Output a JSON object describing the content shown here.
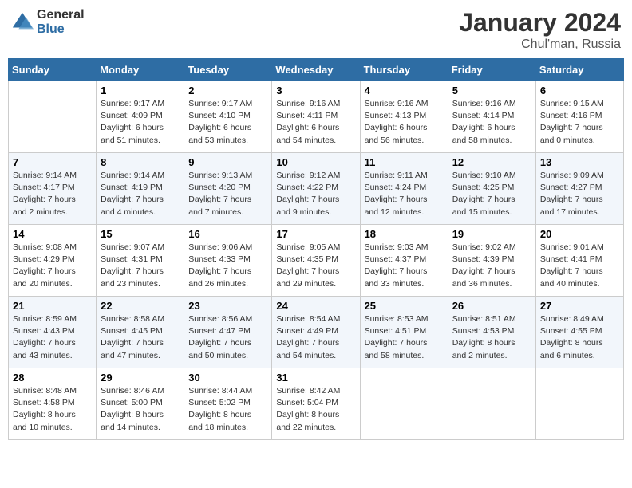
{
  "header": {
    "logo_general": "General",
    "logo_blue": "Blue",
    "title": "January 2024",
    "subtitle": "Chul'man, Russia"
  },
  "columns": [
    "Sunday",
    "Monday",
    "Tuesday",
    "Wednesday",
    "Thursday",
    "Friday",
    "Saturday"
  ],
  "weeks": [
    [
      {
        "num": "",
        "sunrise": "",
        "sunset": "",
        "daylight": ""
      },
      {
        "num": "1",
        "sunrise": "Sunrise: 9:17 AM",
        "sunset": "Sunset: 4:09 PM",
        "daylight": "Daylight: 6 hours and 51 minutes."
      },
      {
        "num": "2",
        "sunrise": "Sunrise: 9:17 AM",
        "sunset": "Sunset: 4:10 PM",
        "daylight": "Daylight: 6 hours and 53 minutes."
      },
      {
        "num": "3",
        "sunrise": "Sunrise: 9:16 AM",
        "sunset": "Sunset: 4:11 PM",
        "daylight": "Daylight: 6 hours and 54 minutes."
      },
      {
        "num": "4",
        "sunrise": "Sunrise: 9:16 AM",
        "sunset": "Sunset: 4:13 PM",
        "daylight": "Daylight: 6 hours and 56 minutes."
      },
      {
        "num": "5",
        "sunrise": "Sunrise: 9:16 AM",
        "sunset": "Sunset: 4:14 PM",
        "daylight": "Daylight: 6 hours and 58 minutes."
      },
      {
        "num": "6",
        "sunrise": "Sunrise: 9:15 AM",
        "sunset": "Sunset: 4:16 PM",
        "daylight": "Daylight: 7 hours and 0 minutes."
      }
    ],
    [
      {
        "num": "7",
        "sunrise": "Sunrise: 9:14 AM",
        "sunset": "Sunset: 4:17 PM",
        "daylight": "Daylight: 7 hours and 2 minutes."
      },
      {
        "num": "8",
        "sunrise": "Sunrise: 9:14 AM",
        "sunset": "Sunset: 4:19 PM",
        "daylight": "Daylight: 7 hours and 4 minutes."
      },
      {
        "num": "9",
        "sunrise": "Sunrise: 9:13 AM",
        "sunset": "Sunset: 4:20 PM",
        "daylight": "Daylight: 7 hours and 7 minutes."
      },
      {
        "num": "10",
        "sunrise": "Sunrise: 9:12 AM",
        "sunset": "Sunset: 4:22 PM",
        "daylight": "Daylight: 7 hours and 9 minutes."
      },
      {
        "num": "11",
        "sunrise": "Sunrise: 9:11 AM",
        "sunset": "Sunset: 4:24 PM",
        "daylight": "Daylight: 7 hours and 12 minutes."
      },
      {
        "num": "12",
        "sunrise": "Sunrise: 9:10 AM",
        "sunset": "Sunset: 4:25 PM",
        "daylight": "Daylight: 7 hours and 15 minutes."
      },
      {
        "num": "13",
        "sunrise": "Sunrise: 9:09 AM",
        "sunset": "Sunset: 4:27 PM",
        "daylight": "Daylight: 7 hours and 17 minutes."
      }
    ],
    [
      {
        "num": "14",
        "sunrise": "Sunrise: 9:08 AM",
        "sunset": "Sunset: 4:29 PM",
        "daylight": "Daylight: 7 hours and 20 minutes."
      },
      {
        "num": "15",
        "sunrise": "Sunrise: 9:07 AM",
        "sunset": "Sunset: 4:31 PM",
        "daylight": "Daylight: 7 hours and 23 minutes."
      },
      {
        "num": "16",
        "sunrise": "Sunrise: 9:06 AM",
        "sunset": "Sunset: 4:33 PM",
        "daylight": "Daylight: 7 hours and 26 minutes."
      },
      {
        "num": "17",
        "sunrise": "Sunrise: 9:05 AM",
        "sunset": "Sunset: 4:35 PM",
        "daylight": "Daylight: 7 hours and 29 minutes."
      },
      {
        "num": "18",
        "sunrise": "Sunrise: 9:03 AM",
        "sunset": "Sunset: 4:37 PM",
        "daylight": "Daylight: 7 hours and 33 minutes."
      },
      {
        "num": "19",
        "sunrise": "Sunrise: 9:02 AM",
        "sunset": "Sunset: 4:39 PM",
        "daylight": "Daylight: 7 hours and 36 minutes."
      },
      {
        "num": "20",
        "sunrise": "Sunrise: 9:01 AM",
        "sunset": "Sunset: 4:41 PM",
        "daylight": "Daylight: 7 hours and 40 minutes."
      }
    ],
    [
      {
        "num": "21",
        "sunrise": "Sunrise: 8:59 AM",
        "sunset": "Sunset: 4:43 PM",
        "daylight": "Daylight: 7 hours and 43 minutes."
      },
      {
        "num": "22",
        "sunrise": "Sunrise: 8:58 AM",
        "sunset": "Sunset: 4:45 PM",
        "daylight": "Daylight: 7 hours and 47 minutes."
      },
      {
        "num": "23",
        "sunrise": "Sunrise: 8:56 AM",
        "sunset": "Sunset: 4:47 PM",
        "daylight": "Daylight: 7 hours and 50 minutes."
      },
      {
        "num": "24",
        "sunrise": "Sunrise: 8:54 AM",
        "sunset": "Sunset: 4:49 PM",
        "daylight": "Daylight: 7 hours and 54 minutes."
      },
      {
        "num": "25",
        "sunrise": "Sunrise: 8:53 AM",
        "sunset": "Sunset: 4:51 PM",
        "daylight": "Daylight: 7 hours and 58 minutes."
      },
      {
        "num": "26",
        "sunrise": "Sunrise: 8:51 AM",
        "sunset": "Sunset: 4:53 PM",
        "daylight": "Daylight: 8 hours and 2 minutes."
      },
      {
        "num": "27",
        "sunrise": "Sunrise: 8:49 AM",
        "sunset": "Sunset: 4:55 PM",
        "daylight": "Daylight: 8 hours and 6 minutes."
      }
    ],
    [
      {
        "num": "28",
        "sunrise": "Sunrise: 8:48 AM",
        "sunset": "Sunset: 4:58 PM",
        "daylight": "Daylight: 8 hours and 10 minutes."
      },
      {
        "num": "29",
        "sunrise": "Sunrise: 8:46 AM",
        "sunset": "Sunset: 5:00 PM",
        "daylight": "Daylight: 8 hours and 14 minutes."
      },
      {
        "num": "30",
        "sunrise": "Sunrise: 8:44 AM",
        "sunset": "Sunset: 5:02 PM",
        "daylight": "Daylight: 8 hours and 18 minutes."
      },
      {
        "num": "31",
        "sunrise": "Sunrise: 8:42 AM",
        "sunset": "Sunset: 5:04 PM",
        "daylight": "Daylight: 8 hours and 22 minutes."
      },
      {
        "num": "",
        "sunrise": "",
        "sunset": "",
        "daylight": ""
      },
      {
        "num": "",
        "sunrise": "",
        "sunset": "",
        "daylight": ""
      },
      {
        "num": "",
        "sunrise": "",
        "sunset": "",
        "daylight": ""
      }
    ]
  ]
}
